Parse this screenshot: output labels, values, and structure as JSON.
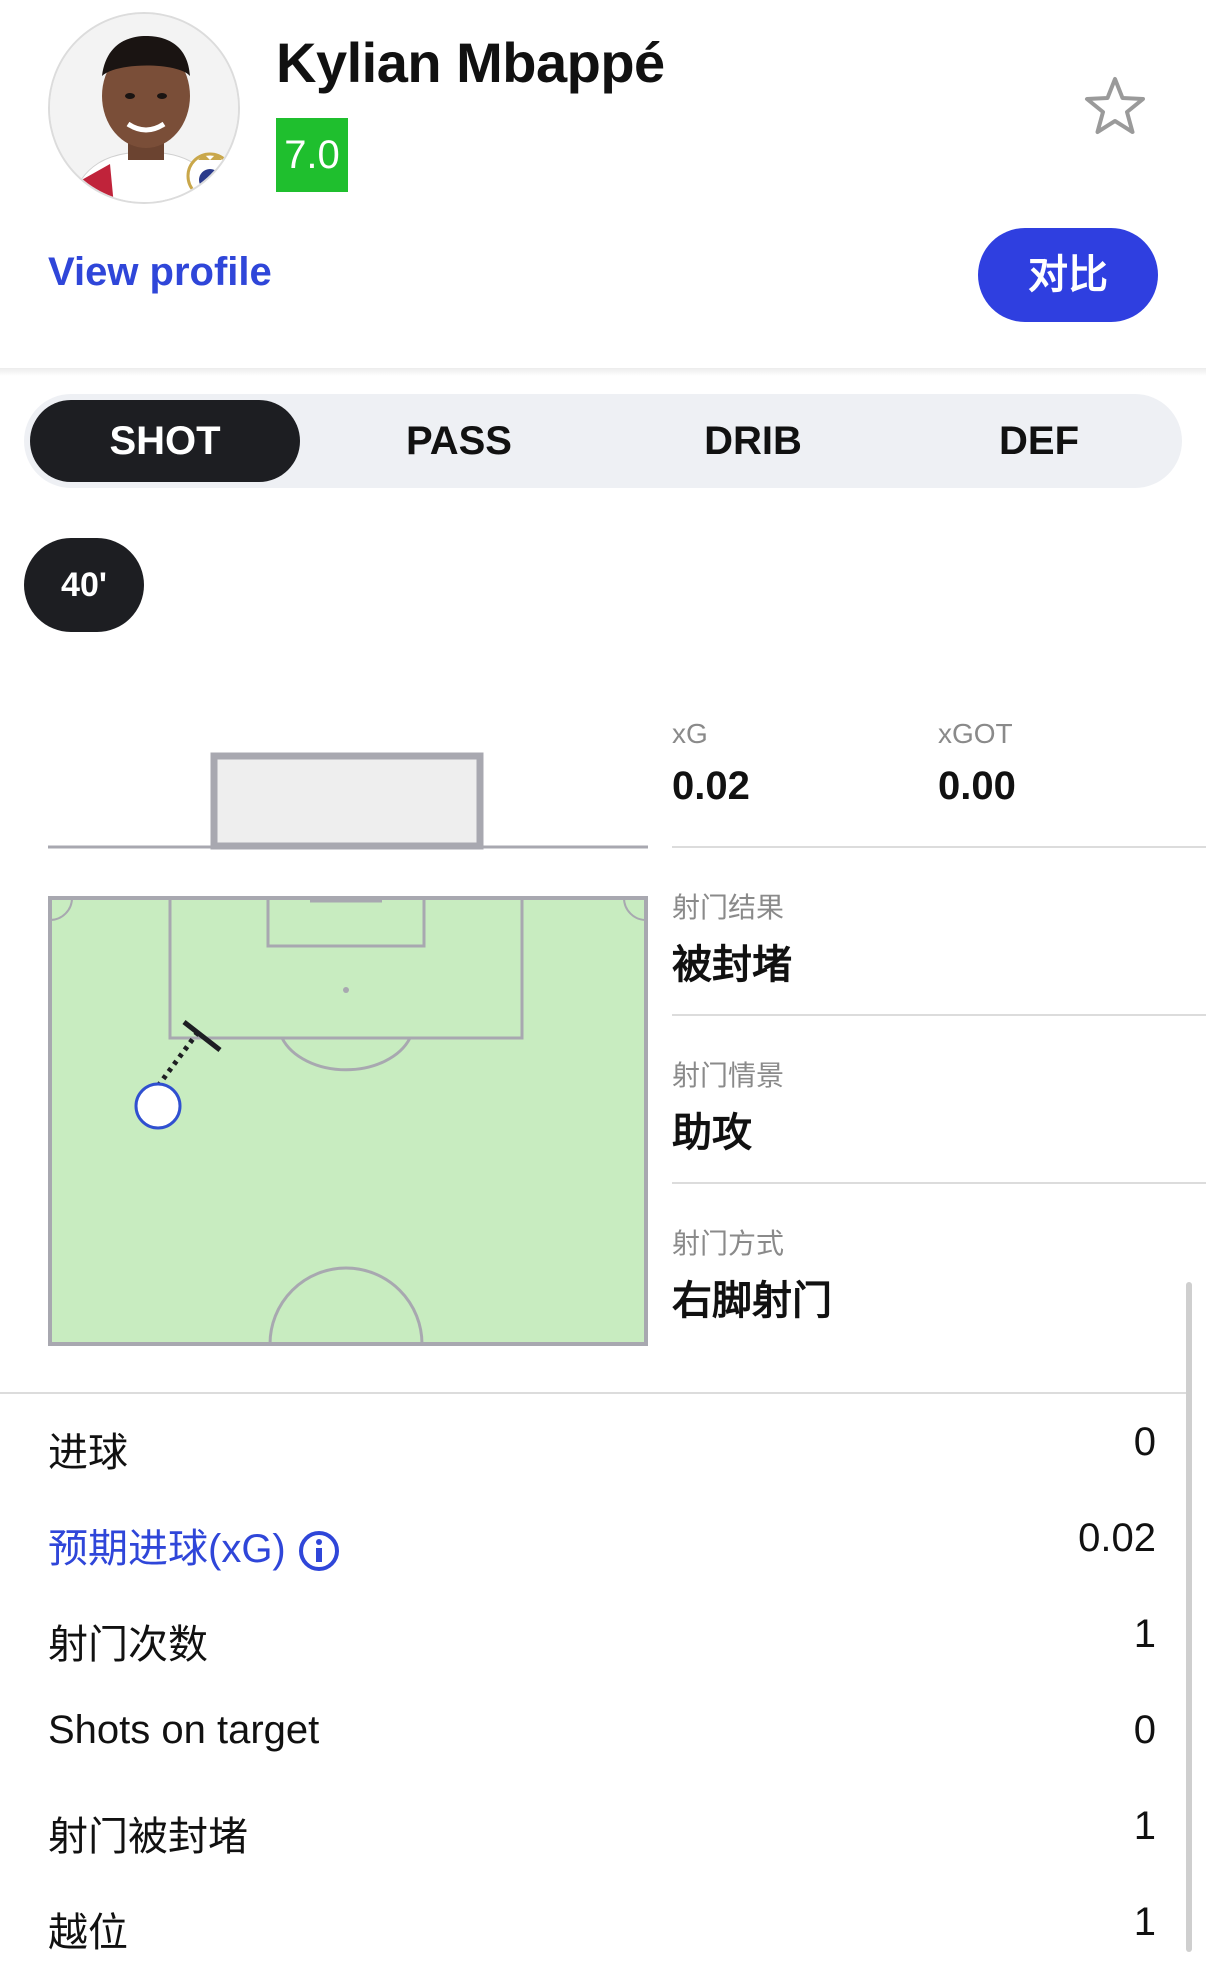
{
  "player": {
    "name": "Kylian Mbappé",
    "rating": "7.0",
    "rating_color": "#1fbf2e",
    "view_profile": "View profile",
    "compare_label": "对比",
    "favorite_icon": "star-outline-icon"
  },
  "tabs": [
    {
      "label": "SHOT",
      "active": true
    },
    {
      "label": "PASS",
      "active": false
    },
    {
      "label": "DRIB",
      "active": false
    },
    {
      "label": "DEF",
      "active": false
    }
  ],
  "shot": {
    "minute": "40'",
    "xg_label": "xG",
    "xg_value": "0.02",
    "xgot_label": "xGOT",
    "xgot_value": "0.00",
    "result_label": "射门结果",
    "result_value": "被封堵",
    "situation_label": "射门情景",
    "situation_value": "助攻",
    "type_label": "射门方式",
    "type_value": "右脚射门"
  },
  "stats": [
    {
      "label": "进球",
      "value": "0",
      "link": false
    },
    {
      "label": "预期进球(xG)",
      "value": "0.02",
      "link": true
    },
    {
      "label": "射门次数",
      "value": "1",
      "link": false
    },
    {
      "label": "Shots on target",
      "value": "0",
      "link": false
    },
    {
      "label": "射门被封堵",
      "value": "1",
      "link": false
    },
    {
      "label": "越位",
      "value": "1",
      "link": false
    }
  ],
  "colors": {
    "accent": "#2f46d9",
    "pitch": "#c8ecc0",
    "dark": "#1d1e22"
  }
}
